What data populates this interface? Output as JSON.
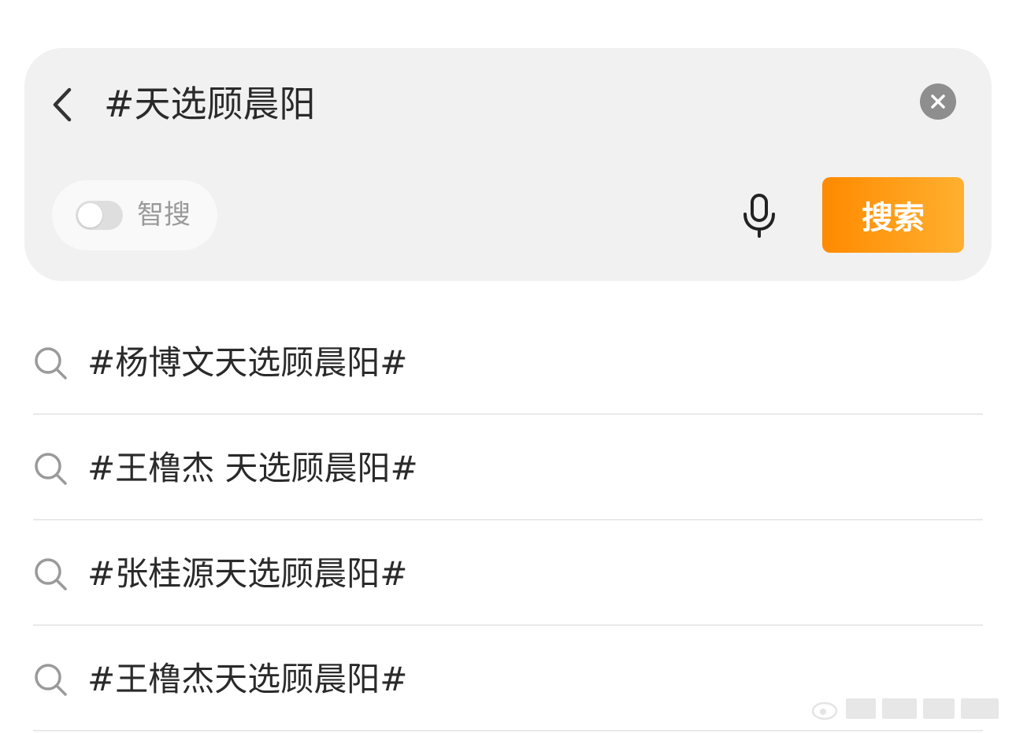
{
  "search": {
    "query": "#天选顾晨阳",
    "smart_search_label": "智搜",
    "smart_search_enabled": false,
    "submit_label": "搜索"
  },
  "suggestions": [
    {
      "text": "#杨博文天选顾晨阳#"
    },
    {
      "text": "#王橹杰 天选顾晨阳#"
    },
    {
      "text": "#张桂源天选顾晨阳#"
    },
    {
      "text": "#王橹杰天选顾晨阳#"
    }
  ],
  "icons": {
    "back": "chevron-left-icon",
    "clear": "close-circle-icon",
    "voice": "microphone-icon",
    "suggestion": "search-icon"
  },
  "colors": {
    "panel_bg": "#f1f1f1",
    "accent_start": "#ff8a00",
    "accent_end": "#ffb030",
    "text": "#2a2a2a",
    "muted": "#9a9a9a"
  }
}
